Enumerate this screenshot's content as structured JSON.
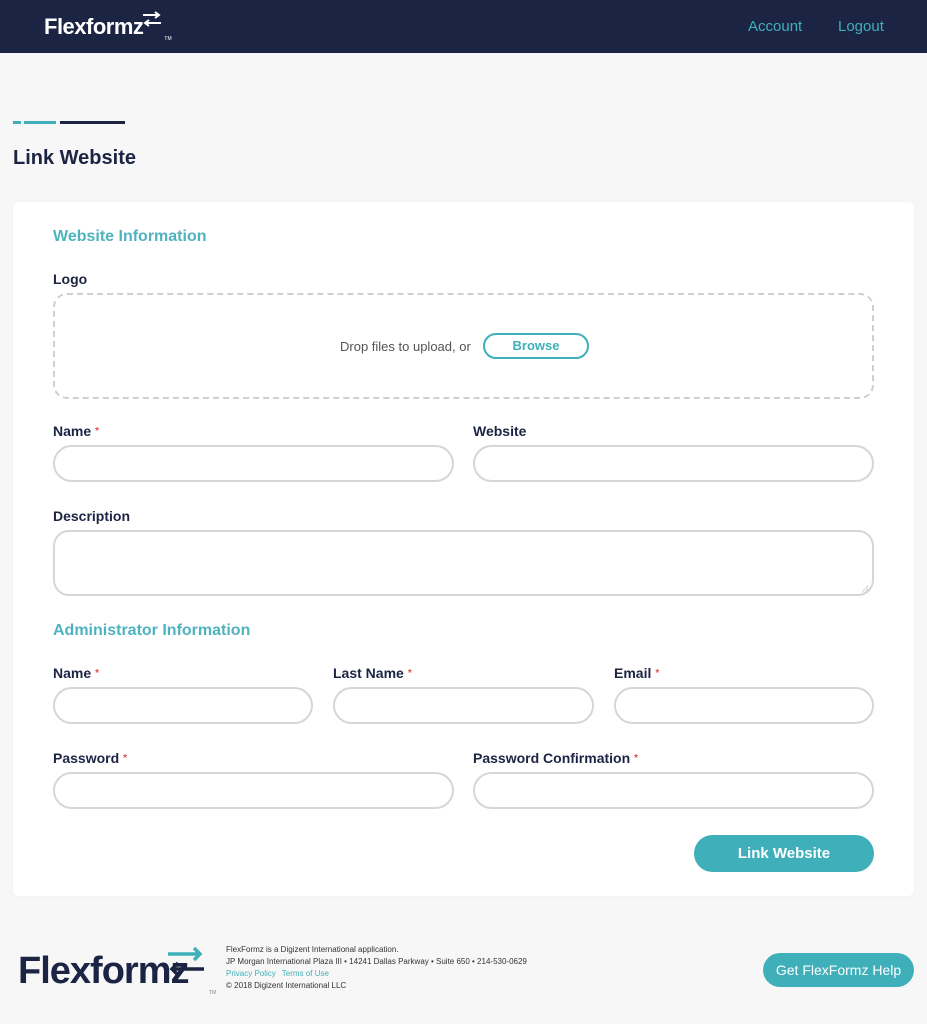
{
  "header": {
    "brand": "Flexformz",
    "brand_tm": "TM",
    "nav": {
      "account": "Account",
      "logout": "Logout"
    }
  },
  "page": {
    "title": "Link Website"
  },
  "website_section": {
    "title": "Website Information",
    "logo_label": "Logo",
    "drop_text": "Drop files to upload, or",
    "browse_label": "Browse",
    "name_label": "Name",
    "name_value": "",
    "website_label": "Website",
    "website_value": "",
    "description_label": "Description",
    "description_value": ""
  },
  "admin_section": {
    "title": "Administrator Information",
    "name_label": "Name",
    "last_name_label": "Last Name",
    "email_label": "Email",
    "password_label": "Password",
    "password_confirm_label": "Password Confirmation"
  },
  "required_marker": "*",
  "submit_label": "Link Website",
  "footer": {
    "brand": "Flexformz",
    "tm": "TM",
    "line1": "FlexFormz is a Digizent International application.",
    "line2": "JP Morgan International Plaza III • 14241 Dallas Parkway • Suite 650 • 214-530-0629",
    "privacy": "Privacy Policy",
    "terms": "Terms of Use",
    "copyright": "© 2018 Digizent International LLC",
    "help_button": "Get FlexFormz Help"
  },
  "colors": {
    "navy": "#1c2444",
    "teal": "#3fb0ba",
    "required": "#d9534f"
  },
  "icons": {
    "brand_mark": "swap-arrows-icon"
  }
}
